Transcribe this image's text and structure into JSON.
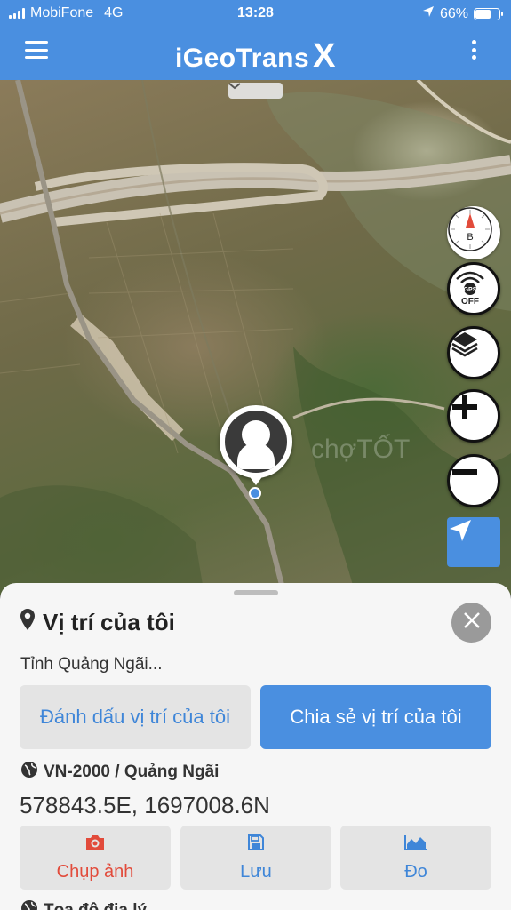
{
  "status_bar": {
    "carrier": "MobiFone",
    "network": "4G",
    "time": "13:28",
    "battery": "66%",
    "battery_level": 0.66
  },
  "header": {
    "title": "iGeoTrans",
    "title_suffix": "X",
    "menu_icon": "hamburger-icon",
    "more_icon": "more-vertical-icon"
  },
  "map": {
    "watermark": "chợTỐT",
    "controls": [
      {
        "name": "compass",
        "icon": "compass-icon",
        "label": "B"
      },
      {
        "name": "gps-toggle",
        "icon": "gps-icon",
        "label": "OFF"
      },
      {
        "name": "layers",
        "icon": "layers-icon"
      },
      {
        "name": "zoom-in",
        "icon": "plus-icon"
      },
      {
        "name": "zoom-out",
        "icon": "minus-icon"
      },
      {
        "name": "locate",
        "icon": "navigation-arrow-icon"
      }
    ]
  },
  "sheet": {
    "title": "Vị trí của tôi",
    "province": "Tỉnh Quảng Ngãi...",
    "mark_button": "Đánh dấu vị trí của tôi",
    "share_button": "Chia sẻ vị trí của tôi",
    "coordinate_system": "VN-2000 / Quảng Ngãi",
    "coordinates": "578843.5E, 1697008.6N",
    "actions": [
      {
        "label": "Chụp ảnh",
        "icon": "camera-icon"
      },
      {
        "label": "Lưu",
        "icon": "save-icon"
      },
      {
        "label": "Đo",
        "icon": "area-chart-icon"
      }
    ],
    "next_row": "Tọa độ địa lý"
  },
  "colors": {
    "primary": "#4a8fe0",
    "danger": "#e24b3b",
    "sheet_bg": "#f6f6f6",
    "button_gray": "#e4e4e4"
  }
}
